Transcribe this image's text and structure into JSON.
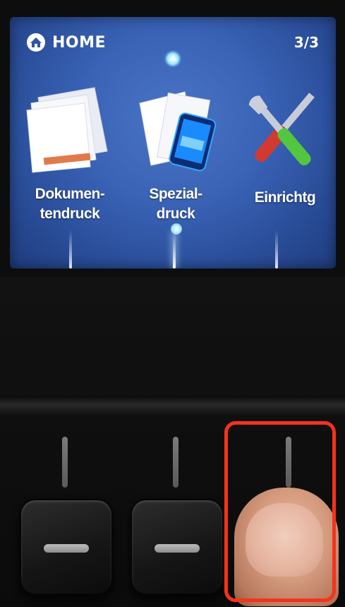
{
  "screen": {
    "header": {
      "title": "HOME",
      "page_indicator": "3/3",
      "icon": "home-icon"
    },
    "scroll_up_icon": "triangle-up-icon",
    "tiles": [
      {
        "label": "Dokumen-\ntendruck",
        "icon": "documents-icon"
      },
      {
        "label": "Spezial-\ndruck",
        "icon": "special-print-icon"
      },
      {
        "label": "Einrichtg",
        "icon": "tools-icon"
      }
    ]
  },
  "panel": {
    "buttons": [
      {
        "name": "left-function-button",
        "icon": "dash-icon"
      },
      {
        "name": "center-function-button",
        "icon": "dash-icon"
      },
      {
        "name": "right-function-button",
        "icon": "dash-icon",
        "highlighted": true
      }
    ]
  },
  "colors": {
    "screen_bg": "#3a63b6",
    "highlight": "#f4331c"
  }
}
